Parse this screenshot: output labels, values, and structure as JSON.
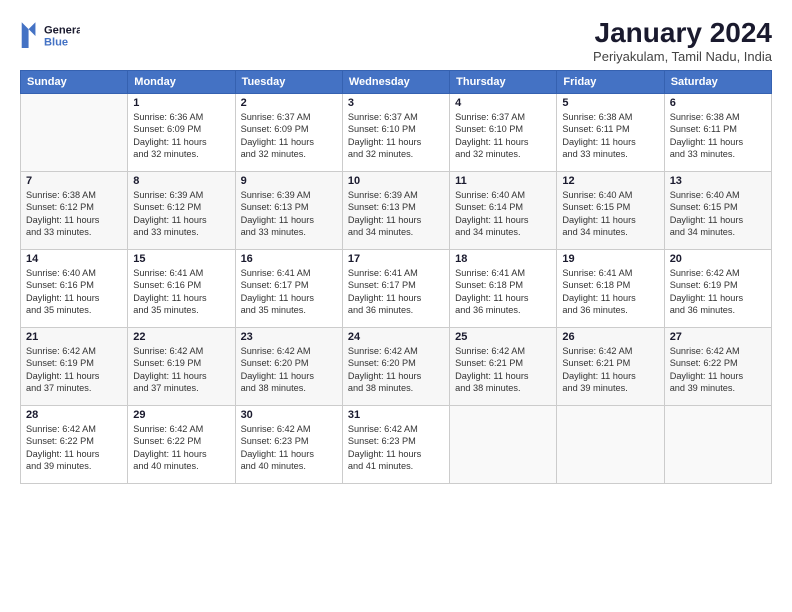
{
  "logo": {
    "line1": "General",
    "line2": "Blue"
  },
  "title": "January 2024",
  "subtitle": "Periyakulam, Tamil Nadu, India",
  "days_header": [
    "Sunday",
    "Monday",
    "Tuesday",
    "Wednesday",
    "Thursday",
    "Friday",
    "Saturday"
  ],
  "weeks": [
    [
      {
        "num": "",
        "info": ""
      },
      {
        "num": "1",
        "info": "Sunrise: 6:36 AM\nSunset: 6:09 PM\nDaylight: 11 hours\nand 32 minutes."
      },
      {
        "num": "2",
        "info": "Sunrise: 6:37 AM\nSunset: 6:09 PM\nDaylight: 11 hours\nand 32 minutes."
      },
      {
        "num": "3",
        "info": "Sunrise: 6:37 AM\nSunset: 6:10 PM\nDaylight: 11 hours\nand 32 minutes."
      },
      {
        "num": "4",
        "info": "Sunrise: 6:37 AM\nSunset: 6:10 PM\nDaylight: 11 hours\nand 32 minutes."
      },
      {
        "num": "5",
        "info": "Sunrise: 6:38 AM\nSunset: 6:11 PM\nDaylight: 11 hours\nand 33 minutes."
      },
      {
        "num": "6",
        "info": "Sunrise: 6:38 AM\nSunset: 6:11 PM\nDaylight: 11 hours\nand 33 minutes."
      }
    ],
    [
      {
        "num": "7",
        "info": "Sunrise: 6:38 AM\nSunset: 6:12 PM\nDaylight: 11 hours\nand 33 minutes."
      },
      {
        "num": "8",
        "info": "Sunrise: 6:39 AM\nSunset: 6:12 PM\nDaylight: 11 hours\nand 33 minutes."
      },
      {
        "num": "9",
        "info": "Sunrise: 6:39 AM\nSunset: 6:13 PM\nDaylight: 11 hours\nand 33 minutes."
      },
      {
        "num": "10",
        "info": "Sunrise: 6:39 AM\nSunset: 6:13 PM\nDaylight: 11 hours\nand 34 minutes."
      },
      {
        "num": "11",
        "info": "Sunrise: 6:40 AM\nSunset: 6:14 PM\nDaylight: 11 hours\nand 34 minutes."
      },
      {
        "num": "12",
        "info": "Sunrise: 6:40 AM\nSunset: 6:15 PM\nDaylight: 11 hours\nand 34 minutes."
      },
      {
        "num": "13",
        "info": "Sunrise: 6:40 AM\nSunset: 6:15 PM\nDaylight: 11 hours\nand 34 minutes."
      }
    ],
    [
      {
        "num": "14",
        "info": "Sunrise: 6:40 AM\nSunset: 6:16 PM\nDaylight: 11 hours\nand 35 minutes."
      },
      {
        "num": "15",
        "info": "Sunrise: 6:41 AM\nSunset: 6:16 PM\nDaylight: 11 hours\nand 35 minutes."
      },
      {
        "num": "16",
        "info": "Sunrise: 6:41 AM\nSunset: 6:17 PM\nDaylight: 11 hours\nand 35 minutes."
      },
      {
        "num": "17",
        "info": "Sunrise: 6:41 AM\nSunset: 6:17 PM\nDaylight: 11 hours\nand 36 minutes."
      },
      {
        "num": "18",
        "info": "Sunrise: 6:41 AM\nSunset: 6:18 PM\nDaylight: 11 hours\nand 36 minutes."
      },
      {
        "num": "19",
        "info": "Sunrise: 6:41 AM\nSunset: 6:18 PM\nDaylight: 11 hours\nand 36 minutes."
      },
      {
        "num": "20",
        "info": "Sunrise: 6:42 AM\nSunset: 6:19 PM\nDaylight: 11 hours\nand 36 minutes."
      }
    ],
    [
      {
        "num": "21",
        "info": "Sunrise: 6:42 AM\nSunset: 6:19 PM\nDaylight: 11 hours\nand 37 minutes."
      },
      {
        "num": "22",
        "info": "Sunrise: 6:42 AM\nSunset: 6:19 PM\nDaylight: 11 hours\nand 37 minutes."
      },
      {
        "num": "23",
        "info": "Sunrise: 6:42 AM\nSunset: 6:20 PM\nDaylight: 11 hours\nand 38 minutes."
      },
      {
        "num": "24",
        "info": "Sunrise: 6:42 AM\nSunset: 6:20 PM\nDaylight: 11 hours\nand 38 minutes."
      },
      {
        "num": "25",
        "info": "Sunrise: 6:42 AM\nSunset: 6:21 PM\nDaylight: 11 hours\nand 38 minutes."
      },
      {
        "num": "26",
        "info": "Sunrise: 6:42 AM\nSunset: 6:21 PM\nDaylight: 11 hours\nand 39 minutes."
      },
      {
        "num": "27",
        "info": "Sunrise: 6:42 AM\nSunset: 6:22 PM\nDaylight: 11 hours\nand 39 minutes."
      }
    ],
    [
      {
        "num": "28",
        "info": "Sunrise: 6:42 AM\nSunset: 6:22 PM\nDaylight: 11 hours\nand 39 minutes."
      },
      {
        "num": "29",
        "info": "Sunrise: 6:42 AM\nSunset: 6:22 PM\nDaylight: 11 hours\nand 40 minutes."
      },
      {
        "num": "30",
        "info": "Sunrise: 6:42 AM\nSunset: 6:23 PM\nDaylight: 11 hours\nand 40 minutes."
      },
      {
        "num": "31",
        "info": "Sunrise: 6:42 AM\nSunset: 6:23 PM\nDaylight: 11 hours\nand 41 minutes."
      },
      {
        "num": "",
        "info": ""
      },
      {
        "num": "",
        "info": ""
      },
      {
        "num": "",
        "info": ""
      }
    ]
  ]
}
